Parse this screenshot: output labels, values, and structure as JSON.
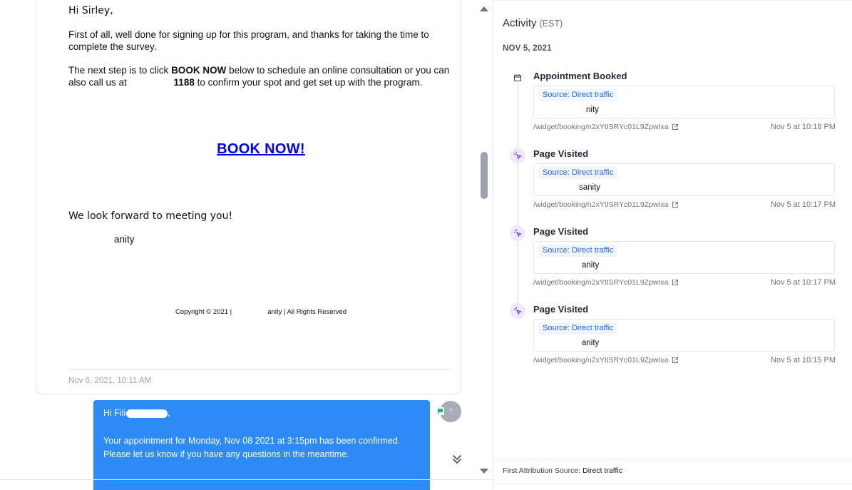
{
  "email": {
    "greeting": "Hi Sirley,",
    "paragraph1": "First of all, well done for signing up for this program, and thanks for taking the time to complete the survey.",
    "p2_before": "The next step is to click ",
    "p2_bold": "BOOK NOW",
    "p2_mid": " below to schedule an online consultation or you can also call us at ",
    "p2_number": "1188",
    "p2_after": " to confirm your spot and get set up with the program.",
    "book_now": "BOOK NOW!",
    "forward": "We look forward to meeting you!",
    "signature": "anity",
    "copyright": "Copyright © 2021 |                   anity | All Rights Reserved",
    "timestamp": "Nov 6, 2021, 10:11 AM"
  },
  "reply": {
    "greeting_start": "Hi Fili",
    "greeting_end": ",",
    "message": "Your appointment for Monday, Nov 08 2021 at 3:15pm has been confirmed. Please let us know if you have any questions in the meantime.",
    "avatar_initial": "?"
  },
  "activity": {
    "title": "Activity",
    "timezone": "(EST)",
    "date_header": "NOV 5, 2021",
    "events": [
      {
        "title": "Appointment Booked",
        "icon": "calendar-icon",
        "source": "Source: Direct traffic",
        "name": "nity",
        "path": "/widget/booking/n2xYtISRYc01L9ZpwIxa",
        "time": "Nov 5 at 10:18 PM"
      },
      {
        "title": "Page Visited",
        "icon": "cursor-click-icon",
        "source": "Source: Direct traffic",
        "name": "sanity",
        "path": "/widget/booking/n2xYtISRYc01L9ZpwIxa",
        "time": "Nov 5 at 10:17 PM"
      },
      {
        "title": "Page Visited",
        "icon": "cursor-click-icon",
        "source": "Source: Direct traffic",
        "name": "anity",
        "path": "/widget/booking/n2xYtISRYc01L9ZpwIxa",
        "time": "Nov 5 at 10:17 PM"
      },
      {
        "title": "Page Visited",
        "icon": "cursor-click-icon",
        "source": "Source: Direct traffic",
        "name": "anity",
        "path": "/widget/booking/n2xYtISRYc01L9ZpwIxa",
        "time": "Nov 5 at 10:15 PM"
      }
    ],
    "first_attribution_label": "First Attribution Source:",
    "first_attribution_value": "Direct traffic"
  },
  "colors": {
    "reply_bubble": "#2d8af7",
    "link": "#0000ee",
    "badge_text": "#2563eb",
    "badge_bg": "#eff6ff",
    "visit_icon_bg": "#ede9fe"
  }
}
